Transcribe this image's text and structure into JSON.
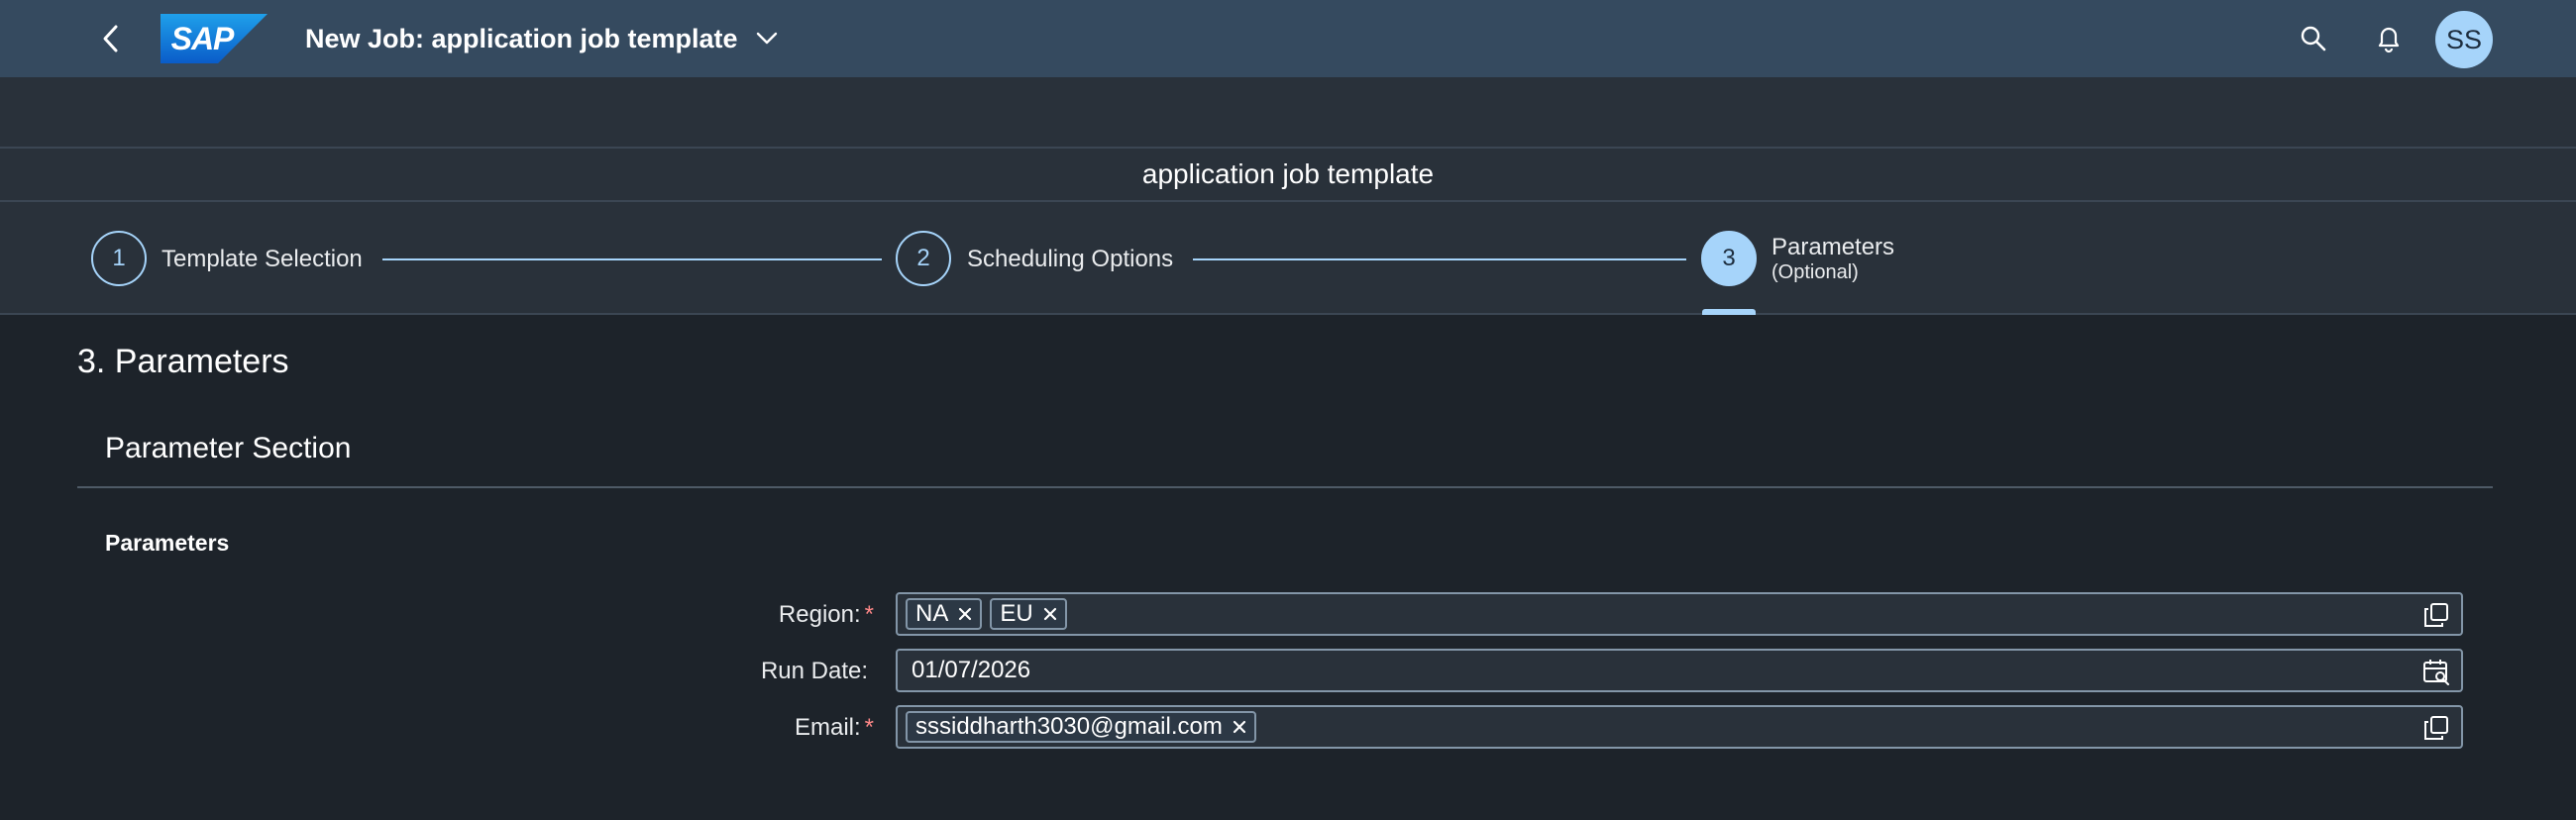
{
  "shell": {
    "logo_text": "SAP",
    "title": "New Job: application job template",
    "avatar_initials": "SS"
  },
  "title_bar": {
    "title": "application job template"
  },
  "wizard": {
    "steps": [
      {
        "number": "1",
        "label": "Template Selection"
      },
      {
        "number": "2",
        "label": "Scheduling Options"
      },
      {
        "number": "3",
        "label": "Parameters",
        "sublabel": "(Optional)"
      }
    ],
    "active_step": 3
  },
  "content": {
    "heading": "3. Parameters",
    "section_title": "Parameter Section",
    "group_title": "Parameters",
    "fields": {
      "region": {
        "label": "Region:",
        "required_mark": "*",
        "tokens": [
          "NA",
          "EU"
        ]
      },
      "run_date": {
        "label": "Run Date:",
        "value": "01/07/2026"
      },
      "email": {
        "label": "Email:",
        "required_mark": "*",
        "tokens": [
          "sssiddharth3030@gmail.com"
        ]
      }
    }
  },
  "icons": {
    "back": "chevron-left-icon",
    "title_menu": "chevron-down-icon",
    "search": "search-icon",
    "notifications": "bell-icon",
    "token_remove": "close-icon",
    "value_help": "value-help-icon",
    "date_picker": "calendar-icon"
  },
  "colors": {
    "shell_bg": "#354a5f",
    "page_bg": "#1d232a",
    "header_bg": "#29313a",
    "accent": "#a6d4fa",
    "required": "#ff8888"
  }
}
